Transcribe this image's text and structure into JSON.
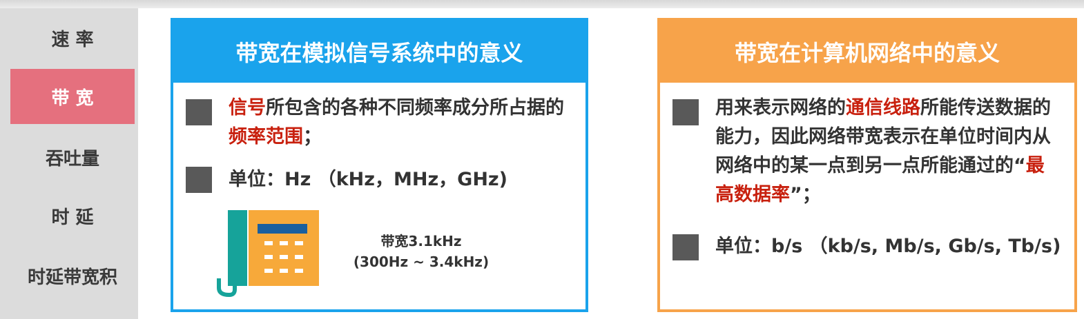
{
  "sidebar": {
    "items": [
      {
        "label": "速 率",
        "active": false
      },
      {
        "label": "带 宽",
        "active": true
      },
      {
        "label": "吞吐量",
        "active": false
      },
      {
        "label": "时 延",
        "active": false
      },
      {
        "label": "时延带宽积",
        "active": false
      }
    ]
  },
  "analog": {
    "title": "带宽在模拟信号系统中的意义",
    "p1": {
      "pre": "",
      "hl1": "信号",
      "mid": "所包含的各种不同频率成分所占据的",
      "hl2": "频率范围",
      "post": "；"
    },
    "unit": "单位：Hz （kHz，MHz，GHz)",
    "caption_line1": "带宽3.1kHz",
    "caption_line2": "(300Hz ~ 3.4kHz)",
    "phone_icon": "telephone-icon"
  },
  "network": {
    "title": "带宽在计算机网络中的意义",
    "p1": {
      "pre": "用来表示网络的",
      "hl1": "通信线路",
      "mid": "所能传送数据的能力，因此网络带宽表示在单位时间内从网络中的某一点到另一点所能通过的“",
      "hl2": "最高数据率",
      "post": "”；"
    },
    "unit": "单位：b/s （kb/s, Mb/s, Gb/s, Tb/s)"
  },
  "colors": {
    "blue": "#1aa3ec",
    "orange": "#f7a34a",
    "active": "#e5707e",
    "highlight": "#c8200e"
  }
}
